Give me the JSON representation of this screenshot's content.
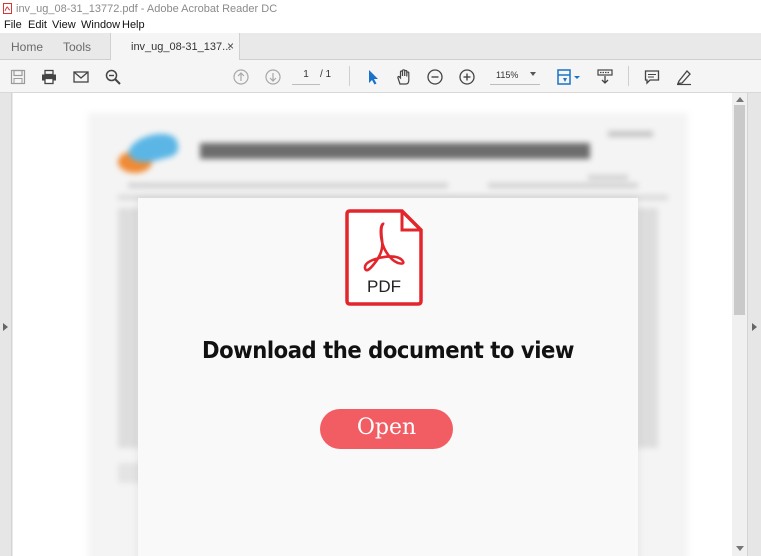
{
  "window": {
    "title": "inv_ug_08-31_13772.pdf - Adobe Acrobat Reader DC"
  },
  "menu": {
    "items": [
      "File",
      "Edit",
      "View",
      "Window",
      "Help"
    ]
  },
  "tabs": {
    "home": "Home",
    "tools": "Tools",
    "document": "inv_ug_08-31_137...",
    "close": "×"
  },
  "toolbar": {
    "page_current": "1",
    "page_total": "/ 1",
    "zoom": "115%"
  },
  "document": {
    "blurred_title": "LAPORAN PEMERIKSAAN KEUANGAN",
    "pdf_icon_label": "PDF",
    "message": "Download the document to view",
    "open_button": "Open"
  },
  "colors": {
    "accent_red": "#e2262c",
    "open_button": "#f25c63",
    "select_tool_blue": "#1a73c8"
  }
}
